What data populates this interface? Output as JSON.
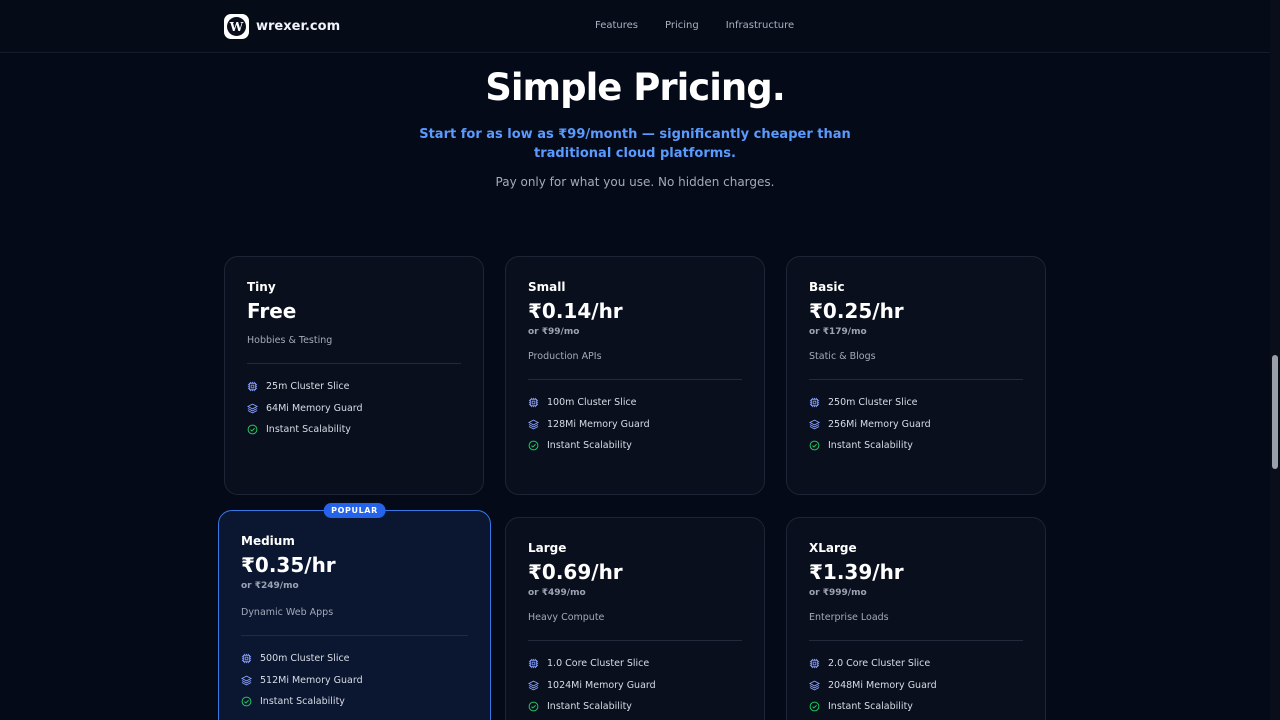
{
  "nav": {
    "logo_letter": "W",
    "brand": "wrexer.com",
    "links": [
      "Features",
      "Pricing",
      "Infrastructure"
    ]
  },
  "hero": {
    "title": "Simple Pricing.",
    "subtitle": "Start for as low as ₹99/month — significantly cheaper than traditional cloud platforms.",
    "note": "Pay only for what you use. No hidden charges."
  },
  "colors": {
    "accent": "#5a9bff",
    "badge": "#2563eb",
    "check": "#22c55e",
    "icon": "#8ba3ff"
  },
  "icons": {
    "cpu": "cpu-icon",
    "memory": "layers-icon",
    "scale": "check-circle-icon"
  },
  "plans": [
    {
      "name": "Tiny",
      "price": "Free",
      "monthly": "",
      "desc": "Hobbies & Testing",
      "features": [
        "25m Cluster Slice",
        "64Mi Memory Guard",
        "Instant Scalability"
      ]
    },
    {
      "name": "Small",
      "price": "₹0.14/hr",
      "monthly": "or ₹99/mo",
      "desc": "Production APIs",
      "features": [
        "100m Cluster Slice",
        "128Mi Memory Guard",
        "Instant Scalability"
      ]
    },
    {
      "name": "Basic",
      "price": "₹0.25/hr",
      "monthly": "or ₹179/mo",
      "desc": "Static & Blogs",
      "features": [
        "250m Cluster Slice",
        "256Mi Memory Guard",
        "Instant Scalability"
      ]
    },
    {
      "name": "Medium",
      "price": "₹0.35/hr",
      "monthly": "or ₹249/mo",
      "desc": "Dynamic Web Apps",
      "badge": "POPULAR",
      "features": [
        "500m Cluster Slice",
        "512Mi Memory Guard",
        "Instant Scalability"
      ]
    },
    {
      "name": "Large",
      "price": "₹0.69/hr",
      "monthly": "or ₹499/mo",
      "desc": "Heavy Compute",
      "features": [
        "1.0 Core Cluster Slice",
        "1024Mi Memory Guard",
        "Instant Scalability"
      ]
    },
    {
      "name": "XLarge",
      "price": "₹1.39/hr",
      "monthly": "or ₹999/mo",
      "desc": "Enterprise Loads",
      "features": [
        "2.0 Core Cluster Slice",
        "2048Mi Memory Guard",
        "Instant Scalability"
      ]
    }
  ]
}
